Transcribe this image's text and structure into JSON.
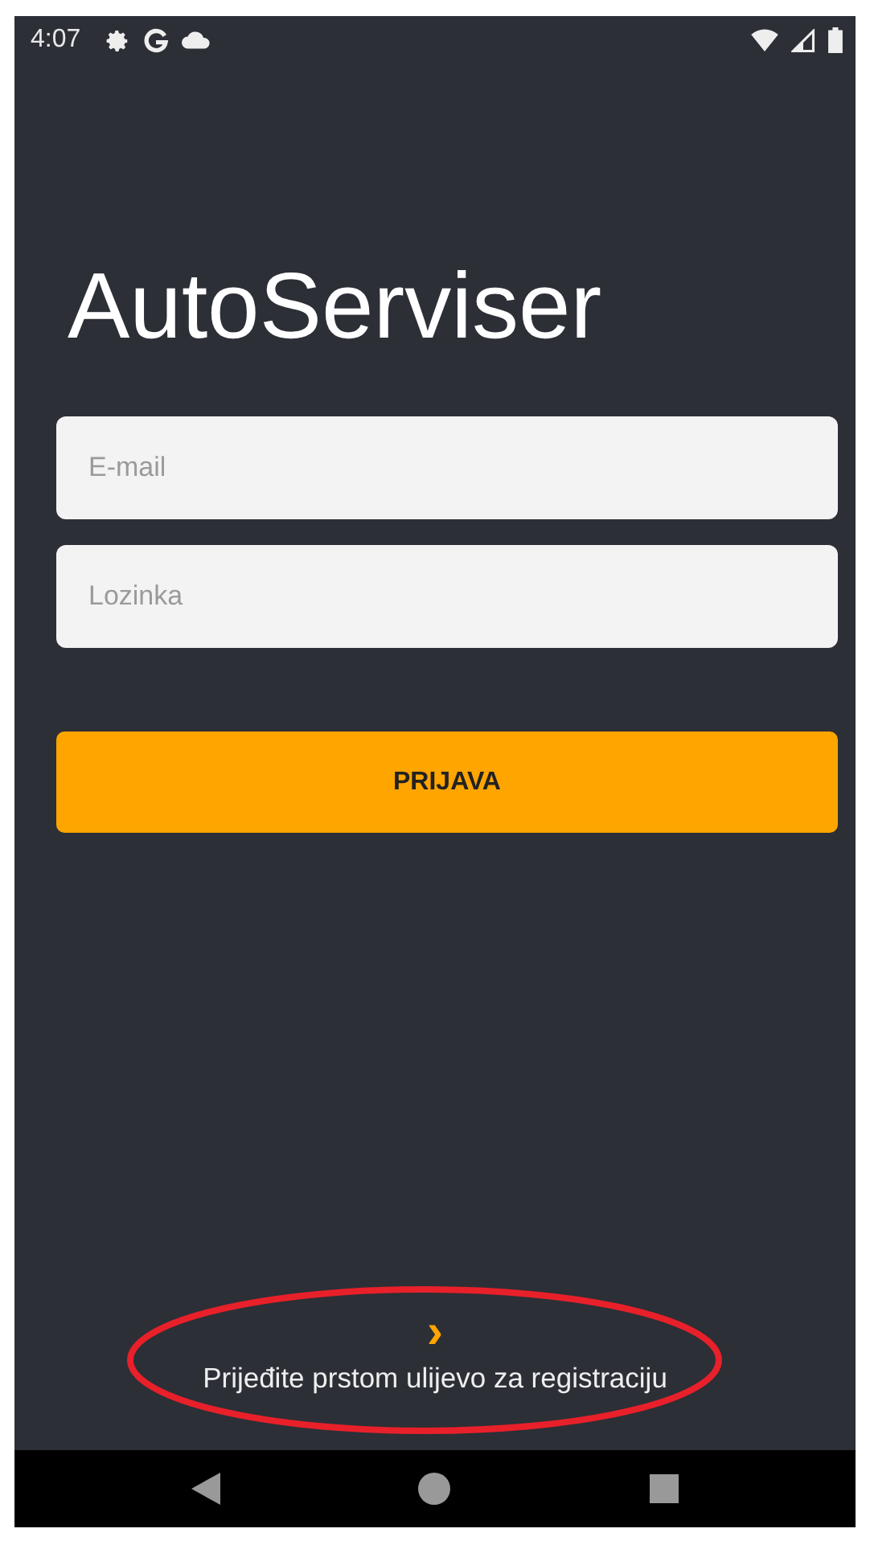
{
  "status_bar": {
    "time": "4:07"
  },
  "app_title": "AutoServiser",
  "fields": [
    {
      "placeholder": "E-mail"
    },
    {
      "placeholder": "Lozinka"
    }
  ],
  "login_button": "PRIJAVA",
  "swipe_hint": {
    "arrow": "›",
    "text": "Prijeđite prstom ulijevo za registraciju",
    "highlighted": true
  }
}
